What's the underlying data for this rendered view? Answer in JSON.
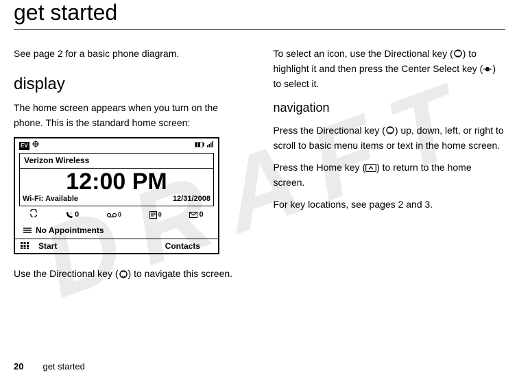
{
  "watermark": "DRAFT",
  "title": "get started",
  "col1": {
    "p1": "See page 2 for a basic phone diagram.",
    "h_display": "display",
    "p2": "The home screen appears when you turn on the phone. This is the standard home screen:",
    "phone": {
      "ev_label": "EV",
      "carrier": "Verizon Wireless",
      "clock": "12:00 PM",
      "wifi_label": "Wi-Fi:",
      "wifi_status": "Available",
      "date": "12/31/2008",
      "counters": {
        "missed_calls": "0",
        "voicemail": "0",
        "messages": "0",
        "email": "0"
      },
      "appointments": "No Appointments",
      "softkey_left": "Start",
      "softkey_right": "Contacts"
    },
    "p3_a": "Use the Directional key (",
    "p3_b": ") to navigate this screen."
  },
  "col2": {
    "p1_a": "To select an icon, use the Directional key (",
    "p1_b": ") to highlight it and then press the Center Select key (",
    "p1_c": ") to select it.",
    "h_nav": "navigation",
    "p2_a": "Press the Directional key (",
    "p2_b": ") up, down, left, or right to scroll to basic menu items or text in the home screen.",
    "p3_a": "Press the Home key (",
    "p3_b": ") to return to the home screen.",
    "p4": "For key locations, see pages 2 and 3."
  },
  "footer": {
    "page": "20",
    "section": "get started"
  }
}
